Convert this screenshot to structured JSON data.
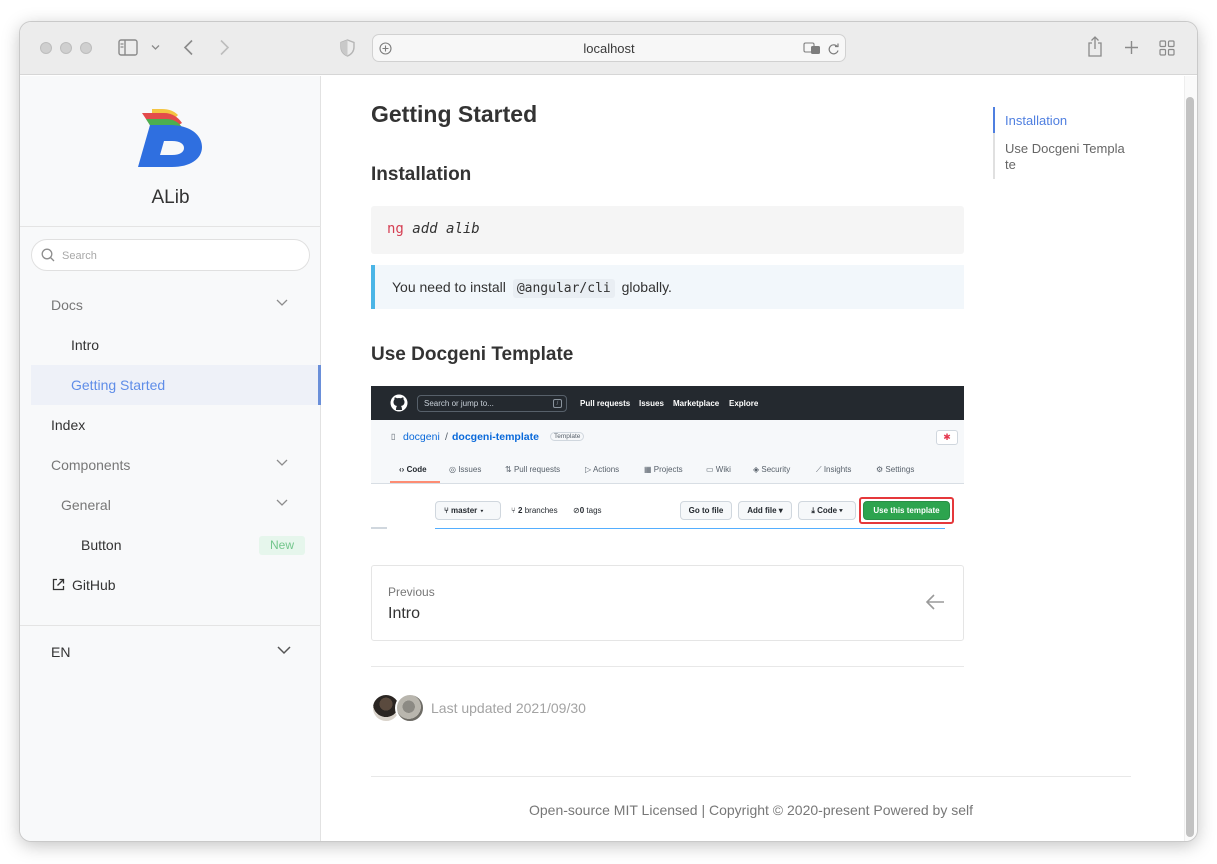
{
  "browser": {
    "url": "localhost"
  },
  "sidebar": {
    "brand": "ALib",
    "search_placeholder": "Search",
    "items": [
      {
        "label": "Docs"
      },
      {
        "label": "Intro"
      },
      {
        "label": "Getting Started"
      },
      {
        "label": "Index"
      },
      {
        "label": "Components"
      },
      {
        "label": "General"
      },
      {
        "label": "Button",
        "badge": "New"
      },
      {
        "label": "GitHub"
      }
    ],
    "language": "EN"
  },
  "main": {
    "title": "Getting Started",
    "installation_heading": "Installation",
    "code_keyword": "ng",
    "code_rest": "add alib",
    "note_before": "You need to install",
    "note_code": "@angular/cli",
    "note_after": "globally.",
    "template_heading": "Use Docgeni Template",
    "screenshot": {
      "search": "Search or jump to...",
      "nav": [
        "Pull requests",
        "Issues",
        "Marketplace",
        "Explore"
      ],
      "repo_owner": "docgeni",
      "repo_sep": "/",
      "repo_name": "docgeni-template",
      "repo_tag": "Template",
      "tabs": [
        "Code",
        "Issues",
        "Pull requests",
        "Actions",
        "Projects",
        "Wiki",
        "Security",
        "Insights",
        "Settings"
      ],
      "branch": "master",
      "branches_count": "2",
      "branches_label": "branches",
      "tags_count": "0",
      "tags_label": "tags",
      "go_to_file": "Go to file",
      "add_file": "Add file",
      "code_btn": "Code",
      "use_template": "Use this template"
    },
    "prev_label": "Previous",
    "prev_title": "Intro",
    "last_updated": "Last updated 2021/09/30",
    "footer": "Open-source MIT Licensed | Copyright © 2020-present Powered by self"
  },
  "toc": {
    "items": [
      "Installation",
      "Use Docgeni Templa",
      "te"
    ]
  },
  "colors": {
    "accent": "#4f7fe0",
    "badge_text": "#73c68c",
    "note_border": "#4bb5e6",
    "template_btn": "#2da44e",
    "highlight_border": "#e5383b"
  }
}
